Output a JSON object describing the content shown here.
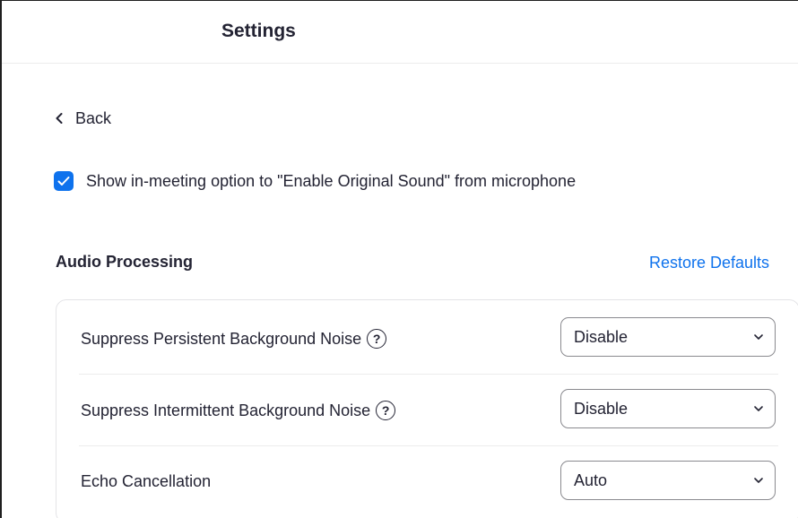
{
  "header": {
    "title": "Settings"
  },
  "nav": {
    "back_label": "Back",
    "back_icon": "chevron-left-icon"
  },
  "original_sound": {
    "checked": true,
    "label": "Show in-meeting option to \"Enable Original Sound\" from microphone"
  },
  "audio_processing": {
    "title": "Audio Processing",
    "restore_label": "Restore Defaults",
    "rows": [
      {
        "label": "Suppress Persistent Background Noise",
        "help": "?",
        "value": "Disable"
      },
      {
        "label": "Suppress Intermittent Background Noise",
        "help": "?",
        "value": "Disable"
      },
      {
        "label": "Echo Cancellation",
        "value": "Auto"
      }
    ]
  },
  "colors": {
    "accent": "#0e72ed",
    "text": "#232333",
    "border": "#e4e4e7"
  }
}
